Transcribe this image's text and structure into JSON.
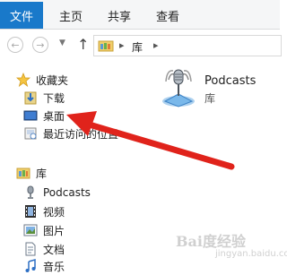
{
  "ribbon": {
    "tabs": [
      "文件",
      "主页",
      "共享",
      "查看"
    ]
  },
  "address": {
    "path_item": "库"
  },
  "nav": {
    "favorites_label": "收藏夹",
    "downloads_label": "下载",
    "desktop_label": "桌面",
    "recent_label": "最近访问的位置",
    "library_label": "库",
    "podcasts_label": "Podcasts",
    "videos_label": "视频",
    "pictures_label": "图片",
    "documents_label": "文档",
    "music_label": "音乐"
  },
  "content": {
    "item_title": "Podcasts",
    "item_subtitle": "库"
  },
  "watermark": {
    "text": "Bai度经验",
    "url": "jingyan.baidu.com"
  },
  "colors": {
    "file_tab": "#1979ca",
    "annotation_arrow": "#e0231b"
  }
}
